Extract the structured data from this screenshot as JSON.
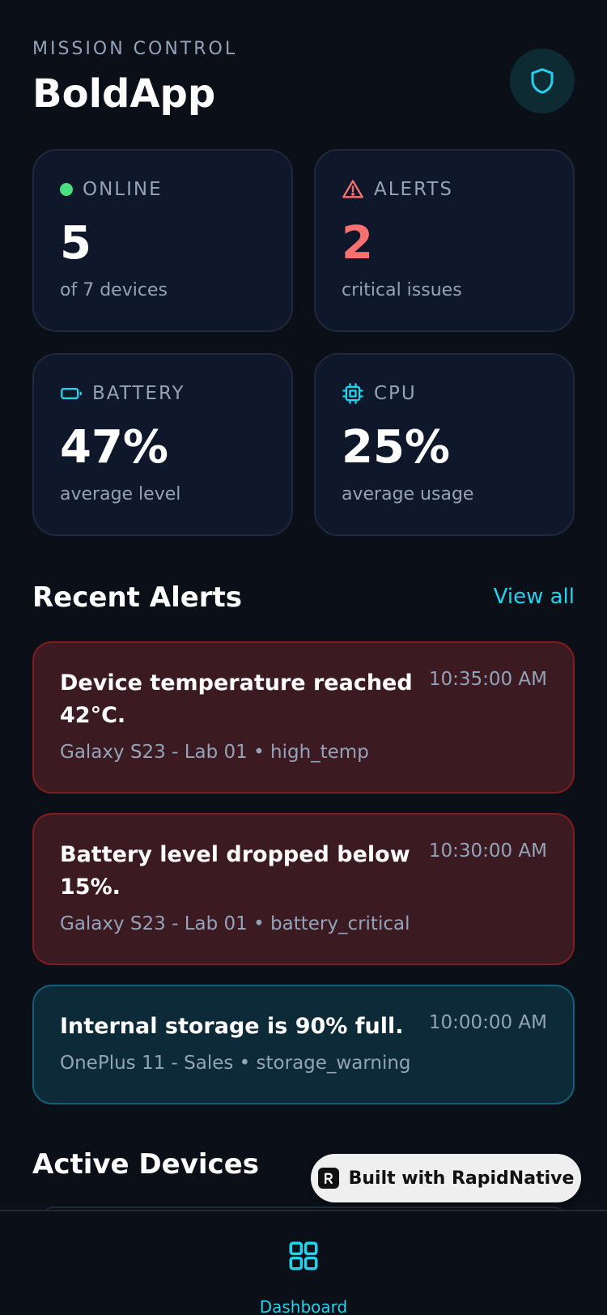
{
  "header": {
    "eyebrow": "MISSION CONTROL",
    "title": "BoldApp",
    "shield_icon": "shield-icon"
  },
  "stats": {
    "online": {
      "label": "ONLINE",
      "value": "5",
      "sub": "of 7 devices",
      "icon": "status-dot",
      "color": "#4ade80"
    },
    "alerts": {
      "label": "ALERTS",
      "value": "2",
      "sub": "critical issues",
      "icon": "warning-triangle-icon",
      "color": "#f87171"
    },
    "battery": {
      "label": "BATTERY",
      "value": "47%",
      "sub": "average level",
      "icon": "battery-icon",
      "color": "#22d3ee"
    },
    "cpu": {
      "label": "CPU",
      "value": "25%",
      "sub": "average usage",
      "icon": "cpu-chip-icon",
      "color": "#22d3ee"
    }
  },
  "recent_alerts": {
    "title": "Recent Alerts",
    "view_all": "View all",
    "items": [
      {
        "message": "Device temperature reached 42°C.",
        "time": "10:35:00 AM",
        "meta": "Galaxy S23 - Lab 01 • high_temp",
        "severity": "critical"
      },
      {
        "message": "Battery level dropped below 15%.",
        "time": "10:30:00 AM",
        "meta": "Galaxy S23 - Lab 01 • battery_critical",
        "severity": "critical"
      },
      {
        "message": "Internal storage is 90% full.",
        "time": "10:00:00 AM",
        "meta": "OnePlus 11 - Sales • storage_warning",
        "severity": "warning"
      }
    ]
  },
  "active_devices": {
    "title": "Active Devices"
  },
  "badge": {
    "text": "Built with RapidNative"
  },
  "tab_bar": {
    "dashboard_label": "Dashboard",
    "dashboard_icon": "grid-icon"
  },
  "colors": {
    "background": "#0a0f18",
    "card": "#0f172a",
    "accent": "#22d3ee",
    "danger": "#f87171",
    "success": "#4ade80",
    "critical_bg": "#3b1a22",
    "warning_bg": "#0c2a38"
  }
}
